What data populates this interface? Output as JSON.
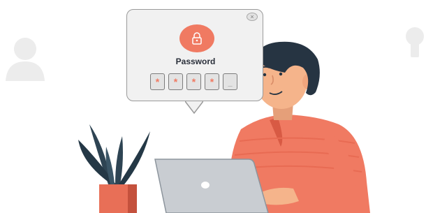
{
  "dialog": {
    "title": "Password",
    "close_glyph": "×",
    "pin_slots": [
      "*",
      "*",
      "*",
      "*",
      "_"
    ],
    "lock_icon": "padlock-icon"
  },
  "colors": {
    "accent": "#f07a62",
    "dialog_bg": "#f1f1f1",
    "hair": "#263442",
    "skin": "#f5b48b",
    "laptop": "#c9cdd2",
    "plant": "#2e4453"
  }
}
